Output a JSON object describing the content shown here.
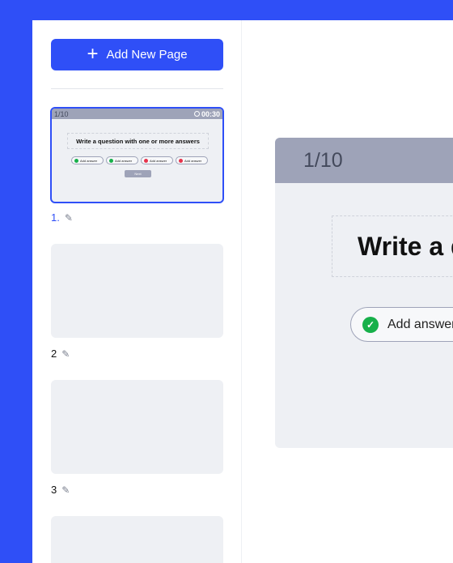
{
  "sidebar": {
    "add_page_label": "Add New Page",
    "pages": [
      {
        "label": "1."
      },
      {
        "label": "2"
      },
      {
        "label": "3"
      }
    ]
  },
  "thumbnail": {
    "counter": "1/10",
    "timer": "00:30",
    "question": "Write a question with one or more answers",
    "answers": [
      {
        "label": "Add answer",
        "status": "correct"
      },
      {
        "label": "Add answer",
        "status": "correct"
      },
      {
        "label": "Add answer",
        "status": "incorrect"
      },
      {
        "label": "Add answer",
        "status": "incorrect"
      }
    ],
    "next_label": "Next"
  },
  "editor": {
    "counter": "1/10",
    "question_text": "Write a question with one or more answers",
    "answer_label": "Add answer"
  },
  "colors": {
    "brand": "#2f4ff7",
    "header_gray": "#9ea3b8",
    "canvas": "#eef0f4",
    "correct": "#17b04a",
    "incorrect": "#e6334b"
  }
}
